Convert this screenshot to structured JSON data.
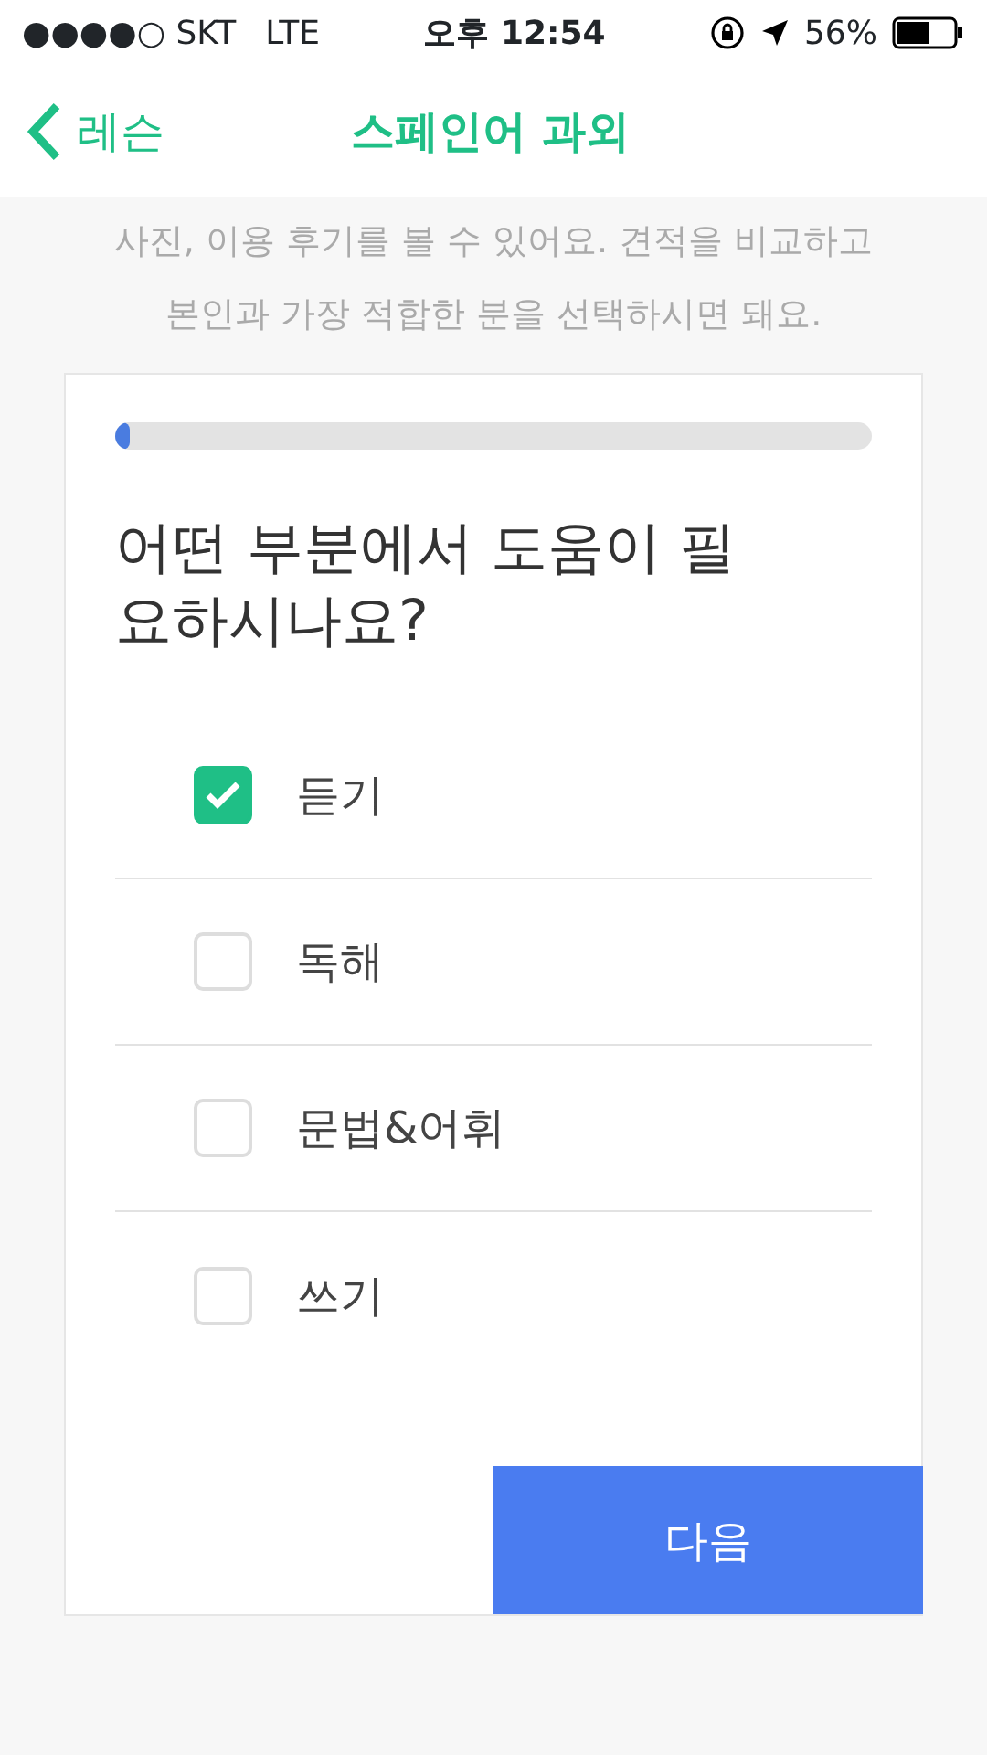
{
  "status_bar": {
    "carrier": "●●●●○ SKT",
    "network": "LTE",
    "time": "오후 12:54",
    "battery": "56%"
  },
  "nav": {
    "back": "레슨",
    "title": "스페인어 과외"
  },
  "intro": [
    "사진, 이용 후기를 볼 수 있어요. 견적을 비교하고",
    "본인과 가장 적합한 분을 선택하시면 돼요."
  ],
  "progress": {
    "level": 0.02
  },
  "question": "어떤 부분에서 도움이 필요하시나요?",
  "options": [
    {
      "label": "듣기",
      "checked": true
    },
    {
      "label": "독해",
      "checked": false
    },
    {
      "label": "문법&어휘",
      "checked": false
    },
    {
      "label": "쓰기",
      "checked": false
    }
  ],
  "next_button": "다음"
}
